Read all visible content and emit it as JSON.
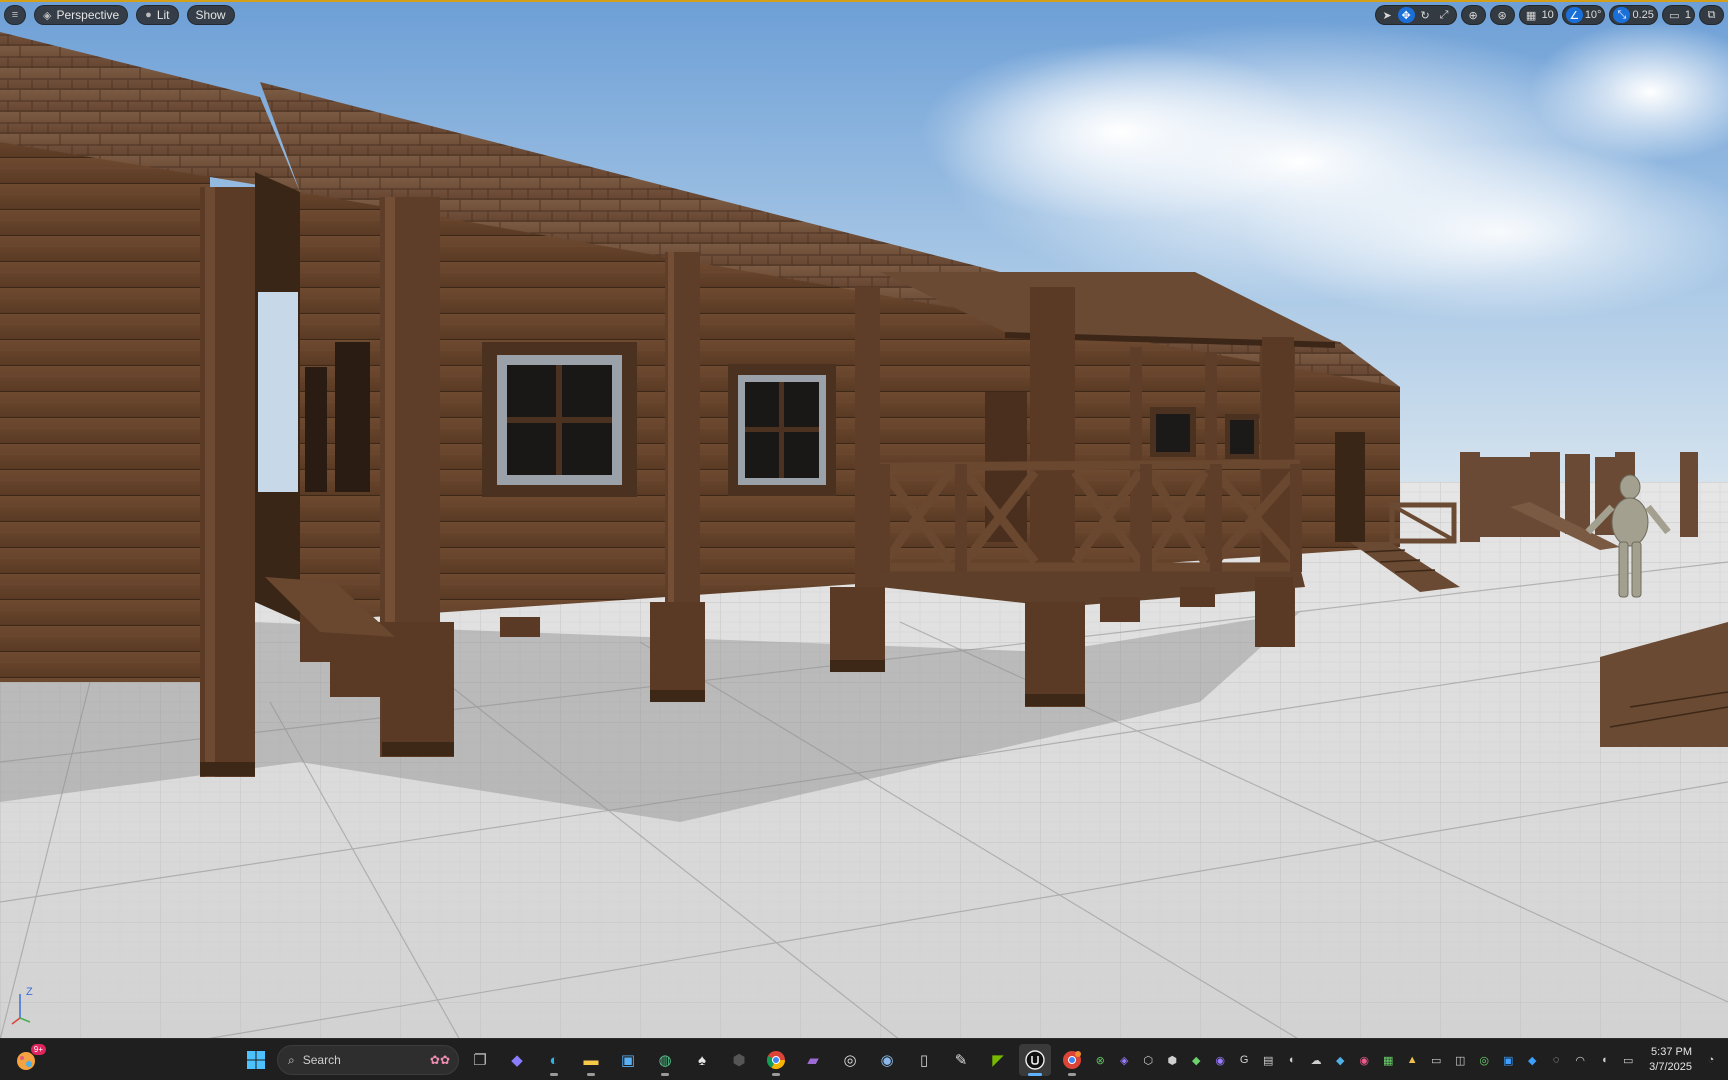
{
  "viewport": {
    "menu_icon": "hamburger-menu-icon",
    "view_mode_label": "Perspective",
    "lighting_label": "Lit",
    "show_label": "Show",
    "grid_snap_value": "10",
    "rotation_snap_value": "10°",
    "scale_snap_value": "0.25",
    "camera_speed_value": "1",
    "axis_z_label": "Z",
    "accent_color": "#1a6fd8",
    "border_color": "#d4a017"
  },
  "taskbar": {
    "widget_badge": "9+",
    "search_placeholder": "Search",
    "time": "5:37 PM",
    "date": "3/7/2025",
    "apps": [
      "start",
      "search",
      "task-view",
      "copilot",
      "edge",
      "file-explorer",
      "microsoft-store",
      "earth",
      "alien",
      "dark-app",
      "chrome",
      "media",
      "obs",
      "steam",
      "remote",
      "notepad",
      "nvidia",
      "unreal-engine",
      "chrome-canary"
    ]
  }
}
